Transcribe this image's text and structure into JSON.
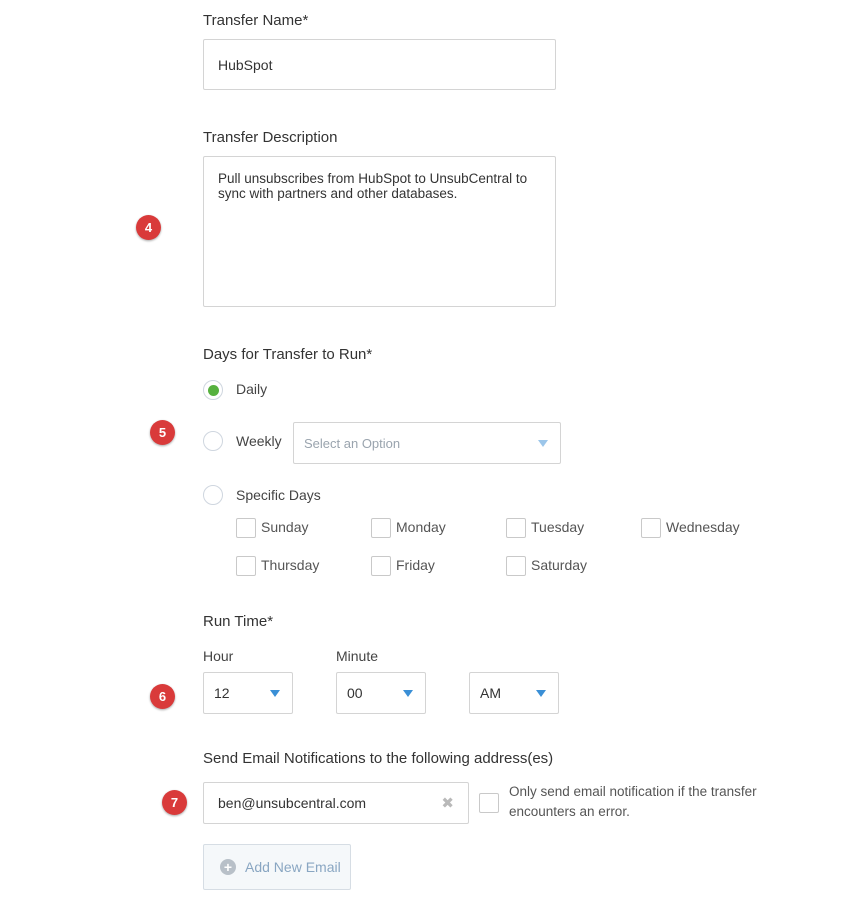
{
  "transfer_name": {
    "label": "Transfer Name*",
    "value": "HubSpot"
  },
  "transfer_description": {
    "label": "Transfer Description",
    "value": "Pull unsubscribes from HubSpot to UnsubCentral to sync with partners and other databases."
  },
  "steps": [
    "4",
    "5",
    "6",
    "7"
  ],
  "days": {
    "label": "Days for Transfer to Run*",
    "options": {
      "daily": "Daily",
      "weekly": "Weekly",
      "specific": "Specific Days"
    },
    "selected": "daily",
    "weekly_select_placeholder": "Select an Option",
    "weekdays": [
      "Sunday",
      "Monday",
      "Tuesday",
      "Wednesday",
      "Thursday",
      "Friday",
      "Saturday"
    ]
  },
  "run_time": {
    "label": "Run Time*",
    "hour_label": "Hour",
    "minute_label": "Minute",
    "hour": "12",
    "minute": "00",
    "ampm": "AM"
  },
  "email": {
    "label": "Send Email Notifications to the following address(es)",
    "value": "ben@unsubcentral.com",
    "error_only_text": "Only send email notification if the transfer encounters an error.",
    "add_button": "Add New Email"
  },
  "colors": {
    "badge": "#d93a3a",
    "radio_selected": "#56b13f",
    "caret": "#3a8fd6"
  }
}
